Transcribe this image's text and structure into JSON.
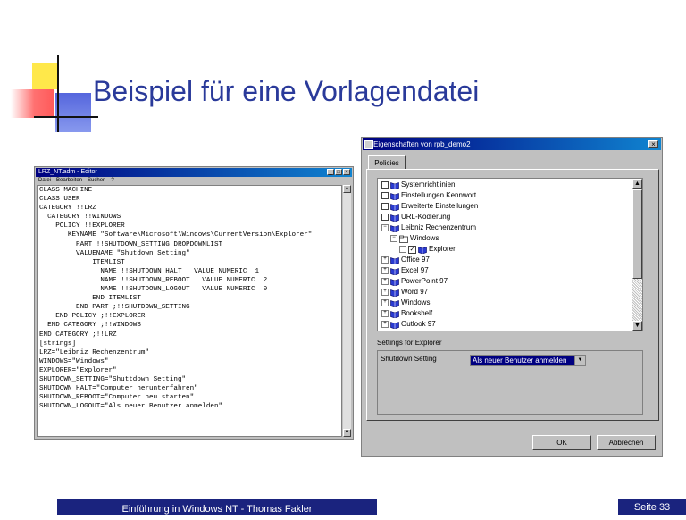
{
  "slide": {
    "title": "Beispiel für eine Vorlagendatei",
    "footer_text": "Einführung in Windows NT - Thomas Fakler",
    "page_label": "Seite 33"
  },
  "editor": {
    "title": "LRZ_NT.adm - Editor",
    "menu": [
      "Datei",
      "Bearbeiten",
      "Suchen",
      "?"
    ],
    "lines": [
      "CLASS MACHINE",
      "CLASS USER",
      "CATEGORY !!LRZ",
      "  CATEGORY !!WINDOWS",
      "    POLICY !!EXPLORER",
      "       KEYNAME \"Software\\Microsoft\\Windows\\CurrentVersion\\Explorer\"",
      "",
      "         PART !!SHUTDOWN_SETTING DROPDOWNLIST",
      "         VALUENAME \"Shutdown Setting\"",
      "             ITEMLIST",
      "               NAME !!SHUTDOWN_HALT   VALUE NUMERIC  1",
      "               NAME !!SHUTDOWN_REBOOT   VALUE NUMERIC  2",
      "               NAME !!SHUTDOWN_LOGOUT   VALUE NUMERIC  0",
      "             END ITEMLIST",
      "         END PART ;!!SHUTDOWN_SETTING",
      "    END POLICY ;!!EXPLORER",
      "  END CATEGORY ;!!WINDOWS",
      "END CATEGORY ;!!LRZ",
      "",
      "[strings]",
      "LRZ=\"Leibniz Rechenzentrum\"",
      "WINDOWS=\"Windows\"",
      "EXPLORER=\"Explorer\"",
      "SHUTDOWN_SETTING=\"Shuttdown Setting\"",
      "SHUTDOWN_HALT=\"Computer herunterfahren\"",
      "SHUTDOWN_REBOOT=\"Computer neu starten\"",
      "SHUTDOWN_LOGOUT=\"Als neuer Benutzer anmelden\""
    ]
  },
  "dialog": {
    "title": "Eigenschaften von rpb_demo2",
    "close_label": "×",
    "tab_label": "Policies",
    "tree": [
      {
        "label": "Systemrichtlinien",
        "expander": "",
        "checkbox": true
      },
      {
        "label": "Einstellungen Kennwort",
        "expander": "",
        "checkbox": true
      },
      {
        "label": "Erweiterte Einstellungen",
        "expander": "",
        "checkbox": true
      },
      {
        "label": "URL-Kodierung",
        "expander": "",
        "checkbox": true
      },
      {
        "label": "Leibniz Rechenzentrum",
        "expander": "−",
        "checkbox": false
      },
      {
        "label": "Windows",
        "expander": "−",
        "checkbox": false
      },
      {
        "label": "Explorer",
        "expander": "",
        "checkbox": true,
        "checked": true
      },
      {
        "label": "Office 97",
        "expander": "+",
        "checkbox": false
      },
      {
        "label": "Excel 97",
        "expander": "+",
        "checkbox": false
      },
      {
        "label": "PowerPoint 97",
        "expander": "+",
        "checkbox": false
      },
      {
        "label": "Word 97",
        "expander": "+",
        "checkbox": false
      },
      {
        "label": "Windows",
        "expander": "+",
        "checkbox": false
      },
      {
        "label": "Bookshelf",
        "expander": "+",
        "checkbox": false
      },
      {
        "label": "Outlook 97",
        "expander": "+",
        "checkbox": false
      }
    ],
    "settings_label": "Settings for Explorer",
    "setting_name": "Shutdown Setting",
    "setting_value": "Als neuer Benutzer anmelden",
    "ok_label": "OK",
    "cancel_label": "Abbrechen"
  },
  "colors": {
    "title": "#2a3a9a",
    "footer_bg": "#1a237e",
    "titlebar": "#000080"
  }
}
